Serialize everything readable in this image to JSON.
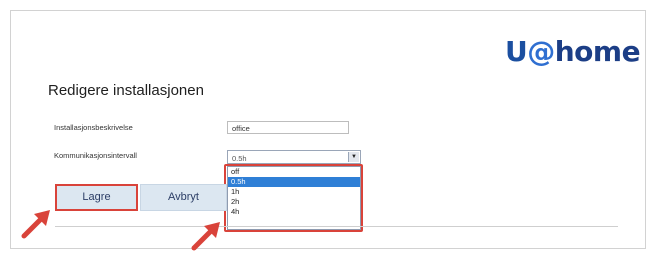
{
  "brand": {
    "u": "U",
    "at": "@",
    "home": "home"
  },
  "page": {
    "title": "Redigere installasjonen"
  },
  "form": {
    "description_label": "Installasjonsbeskrivelse",
    "description_value": "office",
    "interval_label": "Kommunikasjonsintervall",
    "interval_selected": "0.5h",
    "interval_options": [
      "off",
      "0.5h",
      "1h",
      "2h",
      "4h"
    ],
    "highlighted_option_index": 1
  },
  "buttons": {
    "save": "Lagre",
    "cancel": "Avbryt"
  },
  "colors": {
    "brand": "#1b4fa0",
    "highlight": "#d9433a",
    "selection": "#2f7fd6",
    "button": "#dce7f1"
  },
  "icons": {
    "dropdown": "chevron-down-icon",
    "pointer": "arrow-pointer-icon"
  }
}
